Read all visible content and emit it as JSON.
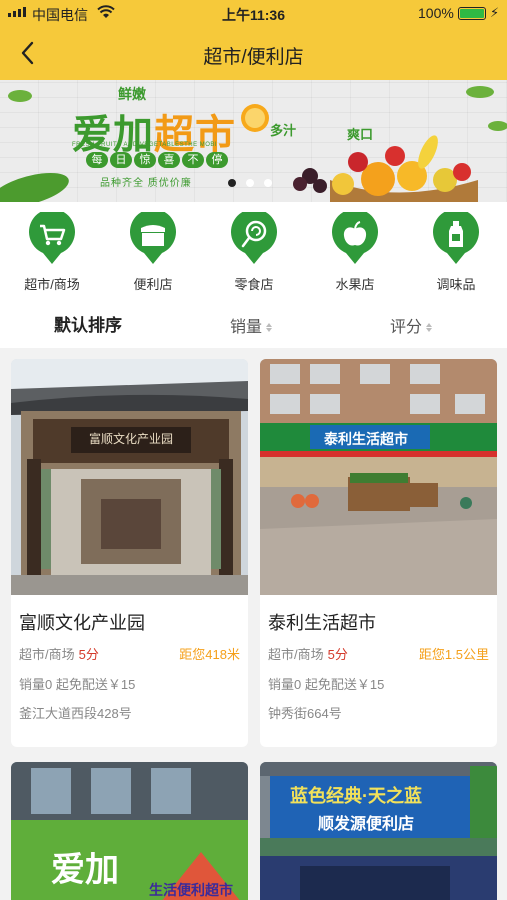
{
  "status": {
    "carrier": "中国电信",
    "time": "上午11:36",
    "battery": "100%",
    "battery_level": 1.0
  },
  "nav": {
    "title": "超市/便利店",
    "back_icon": "chevron-left-icon"
  },
  "banner": {
    "fresh": "鲜嫩",
    "brand_a": "爱加",
    "brand_b": "超市",
    "juicy": "多汁",
    "crisp": "爽口",
    "eng": "FRESH FRUITS AND VEGETABLESTHE MOBI",
    "pills": [
      "每",
      "日",
      "惊",
      "喜",
      "不",
      "停"
    ],
    "sub": "品种齐全 质优价廉",
    "page_count": 3,
    "active_page": 1
  },
  "categories": [
    {
      "label": "超市/商场",
      "icon": "shopping-cart-icon"
    },
    {
      "label": "便利店",
      "icon": "store-icon"
    },
    {
      "label": "零食店",
      "icon": "lollipop-icon"
    },
    {
      "label": "水果店",
      "icon": "apple-icon"
    },
    {
      "label": "调味品",
      "icon": "bottle-icon"
    }
  ],
  "sort": {
    "default": "默认排序",
    "sales": "销量",
    "rating": "评分"
  },
  "stores": [
    {
      "name": "富顺文化产业园",
      "category": "超市/商场",
      "score": "5分",
      "distance": "距您418米",
      "sales": "销量0 起免配送￥15",
      "address": "釜江大道西段428号",
      "sign": "富顺文化产业园"
    },
    {
      "name": "泰利生活超市",
      "category": "超市/商场",
      "score": "5分",
      "distance": "距您1.5公里",
      "sales": "销量0 起免配送￥15",
      "address": "钟秀街664号",
      "sign": "泰利生活超市"
    },
    {
      "sign": "爱加",
      "sign_sub": "生活便利超市"
    },
    {
      "sign": "蓝色经典·天之蓝",
      "sign_sub": "顺发源便利店"
    }
  ],
  "colors": {
    "header": "#f6c93a",
    "category_green": "#2f9a3a",
    "score_red": "#d43a2b",
    "distance_orange": "#f5a01a"
  }
}
